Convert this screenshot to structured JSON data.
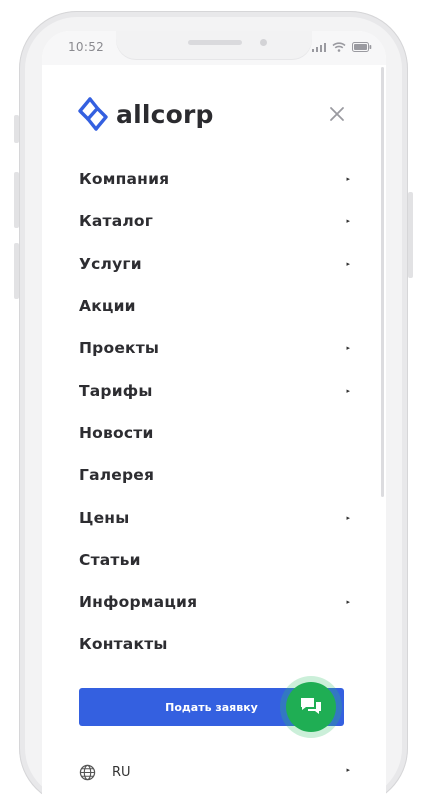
{
  "status_bar": {
    "time": "10:52"
  },
  "brand": {
    "name": "allcorp",
    "accent_color": "#3460e0"
  },
  "menu": {
    "items": [
      {
        "label": "Компания",
        "has_submenu": true
      },
      {
        "label": "Каталог",
        "has_submenu": true
      },
      {
        "label": "Услуги",
        "has_submenu": true
      },
      {
        "label": "Акции",
        "has_submenu": false
      },
      {
        "label": "Проекты",
        "has_submenu": true
      },
      {
        "label": "Тарифы",
        "has_submenu": true
      },
      {
        "label": "Новости",
        "has_submenu": false
      },
      {
        "label": "Галерея",
        "has_submenu": false
      },
      {
        "label": "Цены",
        "has_submenu": true
      },
      {
        "label": "Статьи",
        "has_submenu": false
      },
      {
        "label": "Информация",
        "has_submenu": true
      },
      {
        "label": "Контакты",
        "has_submenu": false
      }
    ],
    "arrow_glyph": "▸"
  },
  "cta": {
    "label": "Подать заявку",
    "color": "#3460e0"
  },
  "chat": {
    "icon": "chat-bubbles-icon",
    "color": "#1fae54"
  },
  "language": {
    "label": "RU",
    "icon": "globe-icon"
  }
}
